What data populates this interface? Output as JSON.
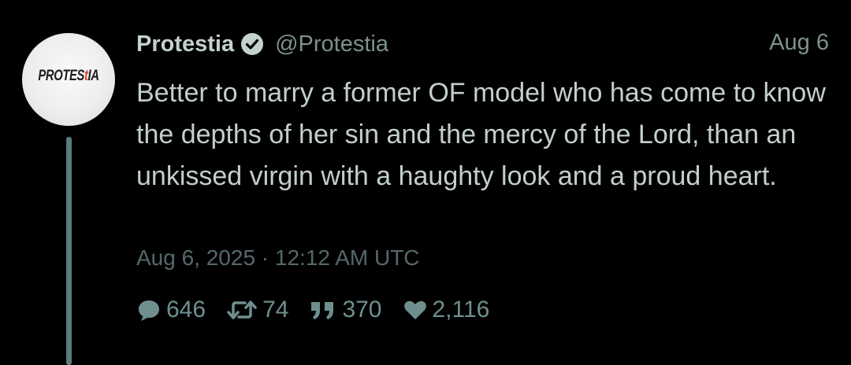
{
  "tweet": {
    "avatar": {
      "logo_main": "PROTES",
      "logo_accent": "t",
      "logo_tail": "IA"
    },
    "author": {
      "display_name": "Protestia",
      "handle": "@Protestia",
      "verified": true
    },
    "date_short": "Aug 6",
    "text": "Better to marry a former OF model who has come to know the depths of her sin and the mercy of the Lord, than an unkissed virgin with a haughty look and a proud heart.",
    "timestamp": "Aug 6, 2025 · 12:12 AM UTC",
    "stats": {
      "comments": "646",
      "retweets": "74",
      "quotes": "370",
      "likes": "2,116"
    }
  },
  "colors": {
    "background": "#000000",
    "name": "#c4d1cd",
    "muted": "#7d918d",
    "thread_line": "#5b7b7c",
    "stat_icon": "#6f8f8f"
  },
  "icons": {
    "verified": "verified-check-icon",
    "comments": "speech-bubble-icon",
    "retweets": "retweet-arrows-icon",
    "quotes": "quote-marks-icon",
    "likes": "heart-icon"
  }
}
